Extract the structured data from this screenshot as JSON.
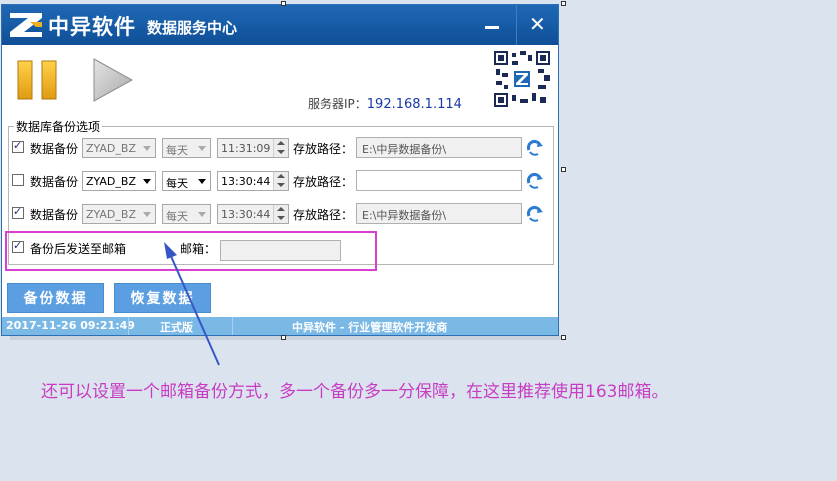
{
  "window": {
    "app_name": "中异软件",
    "app_subtitle": "数据服务中心",
    "close_glyph": "✕"
  },
  "server": {
    "label": "服务器IP：",
    "ip": "192.168.1.114"
  },
  "backup_group": {
    "title": "数据库备份选项",
    "rows": [
      {
        "checked": true,
        "label": "数据备份",
        "database": "ZYAD_BZ",
        "frequency": "每天",
        "time": "11:31:09",
        "path_label": "存放路径：",
        "path": "E:\\中异数据备份\\",
        "enabled": false
      },
      {
        "checked": false,
        "label": "数据备份",
        "database": "ZYAD_BZ",
        "frequency": "每天",
        "time": "13:30:44",
        "path_label": "存放路径：",
        "path": "",
        "enabled": true
      },
      {
        "checked": true,
        "label": "数据备份",
        "database": "ZYAD_BZ",
        "frequency": "每天",
        "time": "13:30:44",
        "path_label": "存放路径：",
        "path": "E:\\中异数据备份\\",
        "enabled": false
      }
    ],
    "email_row": {
      "checked": true,
      "label": "备份后发送至邮箱",
      "email_label": "邮箱：",
      "email_value": ""
    }
  },
  "buttons": {
    "backup": "备份数据",
    "restore": "恢复数据"
  },
  "status_bar": {
    "datetime": "2017-11-26 09:21:49",
    "edition": "正式版",
    "company": "中异软件 - 行业管理软件开发商"
  },
  "annotation": {
    "caption": "还可以设置一个邮箱备份方式，多一个备份多一分保障，在这里推荐使用163邮箱。",
    "color": "#c83cc4"
  },
  "colors": {
    "titlebar": "#1f68b5",
    "button": "#5b9ee1",
    "status": "#7ab8e6"
  }
}
